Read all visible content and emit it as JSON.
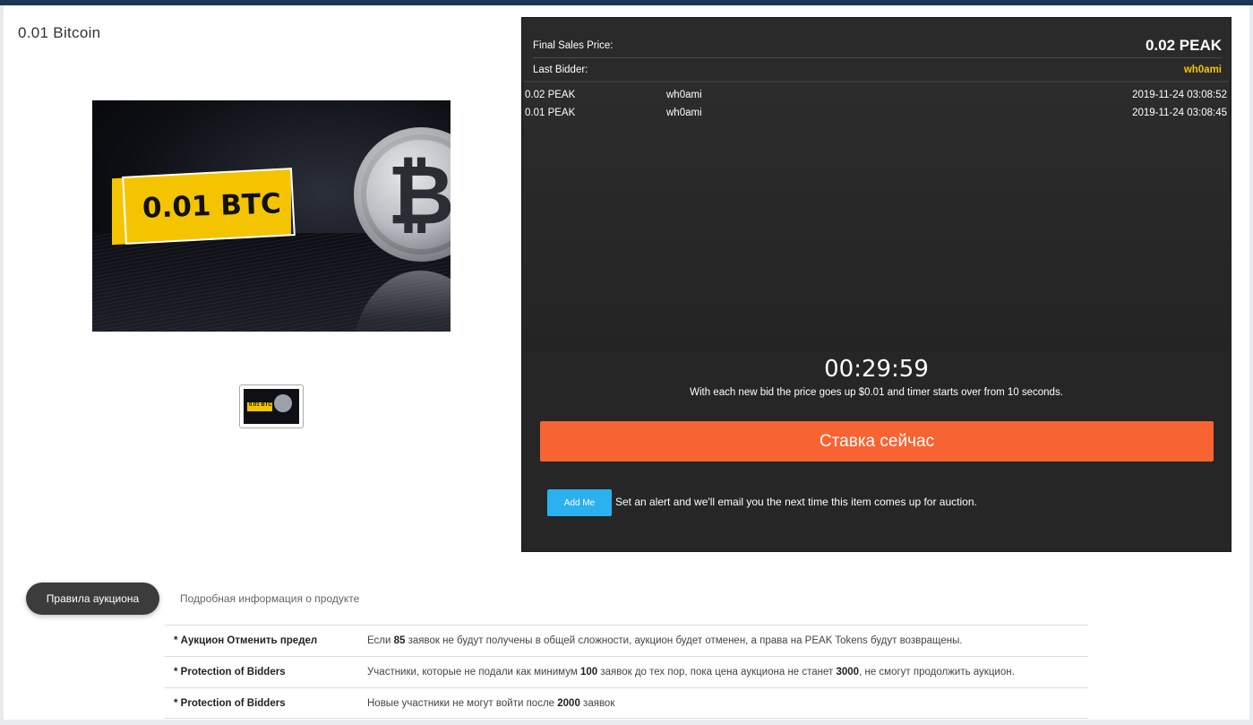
{
  "product": {
    "title": "0.01 Bitcoin",
    "image_badge": "0.01 BTC",
    "thumb_badge": "0.01 BTC"
  },
  "auction": {
    "final_price_label": "Final Sales Price:",
    "final_price": "0.02 PEAK",
    "last_bidder_label": "Last Bidder:",
    "last_bidder": "wh0ami",
    "bids": [
      {
        "amount": "0.02 PEAK",
        "bidder": "wh0ami",
        "time": "2019-11-24 03:08:52"
      },
      {
        "amount": "0.01 PEAK",
        "bidder": "wh0ami",
        "time": "2019-11-24 03:08:45"
      }
    ],
    "timer": "00:29:59",
    "timer_note": "With each new bid the price goes up $0.01 and timer starts over from 10 seconds.",
    "bid_button": "Ставка сейчас",
    "add_me_button": "Add Me",
    "alert_text": "Set an alert and we'll email you the next time this item comes up for auction."
  },
  "tabs": {
    "active": "Правила аукциона",
    "inactive": "Подробная информация о продукте"
  },
  "rules": [
    {
      "name": "* Аукцион Отменить предел",
      "desc_parts": [
        "Если ",
        "85",
        " заявок не будут получены в общей сложности, аукцион будет отменен, а права на PEAK Tokens будут возвращены."
      ]
    },
    {
      "name": "* Protection of Bidders",
      "desc_parts": [
        "Участники, которые не подали как минимум ",
        "100",
        " заявок до тех пор, пока цена аукциона не станет ",
        "3000",
        ", не смогут продолжить аукцион."
      ]
    },
    {
      "name": "* Protection of Bidders",
      "desc_parts": [
        "Новые участники не могут войти после ",
        "2000",
        " заявок"
      ]
    }
  ],
  "colors": {
    "accent_bid": "#f76431",
    "accent_add": "#2bb0f0",
    "bidder_highlight": "#f2c500",
    "panel_bg": "#262626"
  }
}
